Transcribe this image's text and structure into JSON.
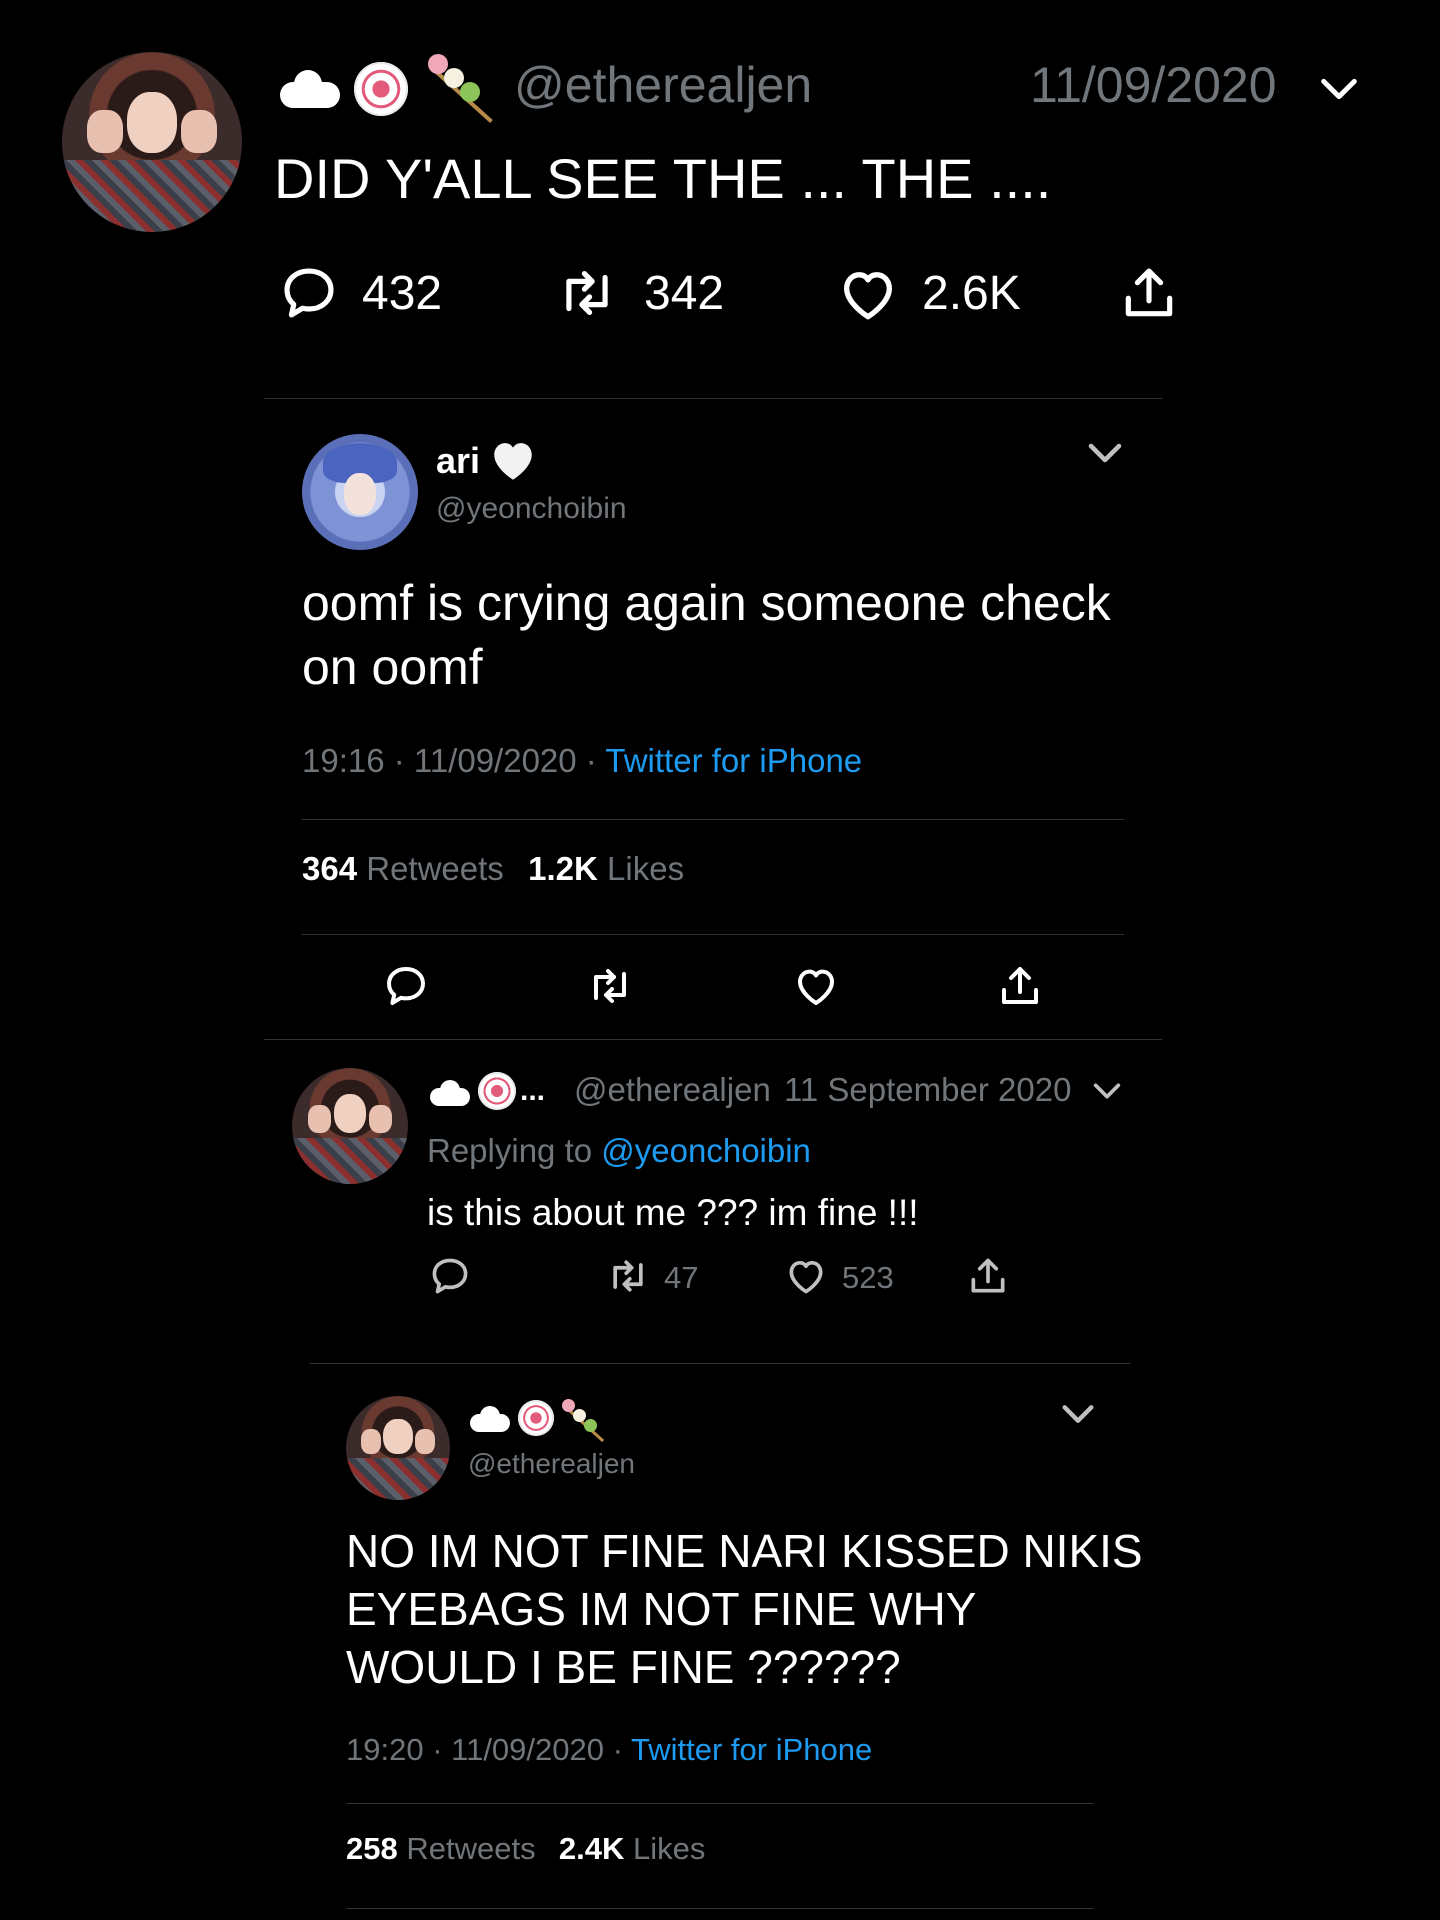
{
  "main_tweet": {
    "handle": "@etherealjen",
    "date": "11/09/2020",
    "text": "DID Y'ALL SEE THE ... THE ....",
    "replies": "432",
    "retweets": "342",
    "likes": "2.6K"
  },
  "thread_tweet": {
    "name": "ari",
    "handle": "@yeonchoibin",
    "text_line1": "oomf is crying again someone check",
    "text_line2": "on oomf",
    "time": "19:16",
    "date": "11/09/2020",
    "source": "Twitter for iPhone",
    "retweet_count": "364",
    "retweet_label": "Retweets",
    "like_count": "1.2K",
    "like_label": "Likes"
  },
  "reply_tweet": {
    "ellipsis": "...",
    "handle": "@etherealjen",
    "date": "11 September 2020",
    "replying_label": "Replying to",
    "replying_handle": "@yeonchoibin",
    "text": "is this about me ??? im fine !!!",
    "retweets": "47",
    "likes": "523"
  },
  "expanded_reply": {
    "handle": "@etherealjen",
    "text_line1": "NO IM NOT FINE NARI KISSED NIKIS",
    "text_line2": "EYEBAGS IM NOT FINE WHY",
    "text_line3": "WOULD I BE FINE ??????",
    "time": "19:20",
    "date": "11/09/2020",
    "source": "Twitter for iPhone",
    "retweet_count": "258",
    "retweet_label": "Retweets",
    "like_count": "2.4K",
    "like_label": "Likes"
  },
  "colors": {
    "background": "#000000",
    "text": "#ffffff",
    "muted": "#71767b",
    "link": "#1d9bf0",
    "divider": "#2f3336"
  },
  "icons": [
    "reply-icon",
    "retweet-icon",
    "heart-icon",
    "share-icon",
    "chevron-down-icon",
    "cloud-emoji",
    "narutomaki-emoji",
    "dango-emoji",
    "white-heart-emoji"
  ]
}
